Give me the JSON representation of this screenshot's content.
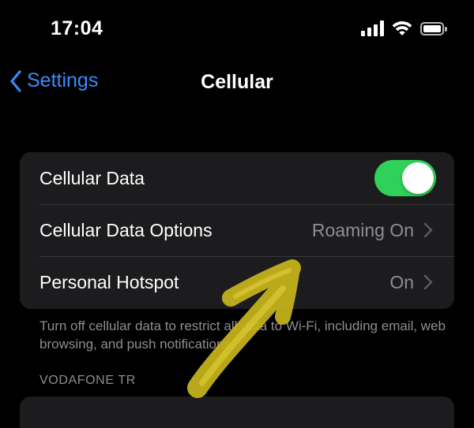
{
  "status_bar": {
    "time": "17:04",
    "icons": [
      "signal-icon",
      "wifi-icon",
      "battery-icon"
    ]
  },
  "nav": {
    "back_label": "Settings",
    "back_icon": "chevron-left-icon",
    "title": "Cellular"
  },
  "main_group": {
    "rows": [
      {
        "label": "Cellular Data",
        "toggle_on": true
      },
      {
        "label": "Cellular Data Options",
        "value": "Roaming On"
      },
      {
        "label": "Personal Hotspot",
        "value": "On"
      }
    ]
  },
  "footnote": "Turn off cellular data to restrict all data to Wi-Fi, including email, web browsing, and push notifications.",
  "carrier_section": {
    "header": "VODAFONE TR"
  },
  "colors": {
    "background": "#000000",
    "group_background": "#1c1c1e",
    "accent_blue": "#3a8afe",
    "toggle_green": "#30d158",
    "secondary_text": "#8e8e93",
    "annotation_arrow": "#d4c21a"
  }
}
